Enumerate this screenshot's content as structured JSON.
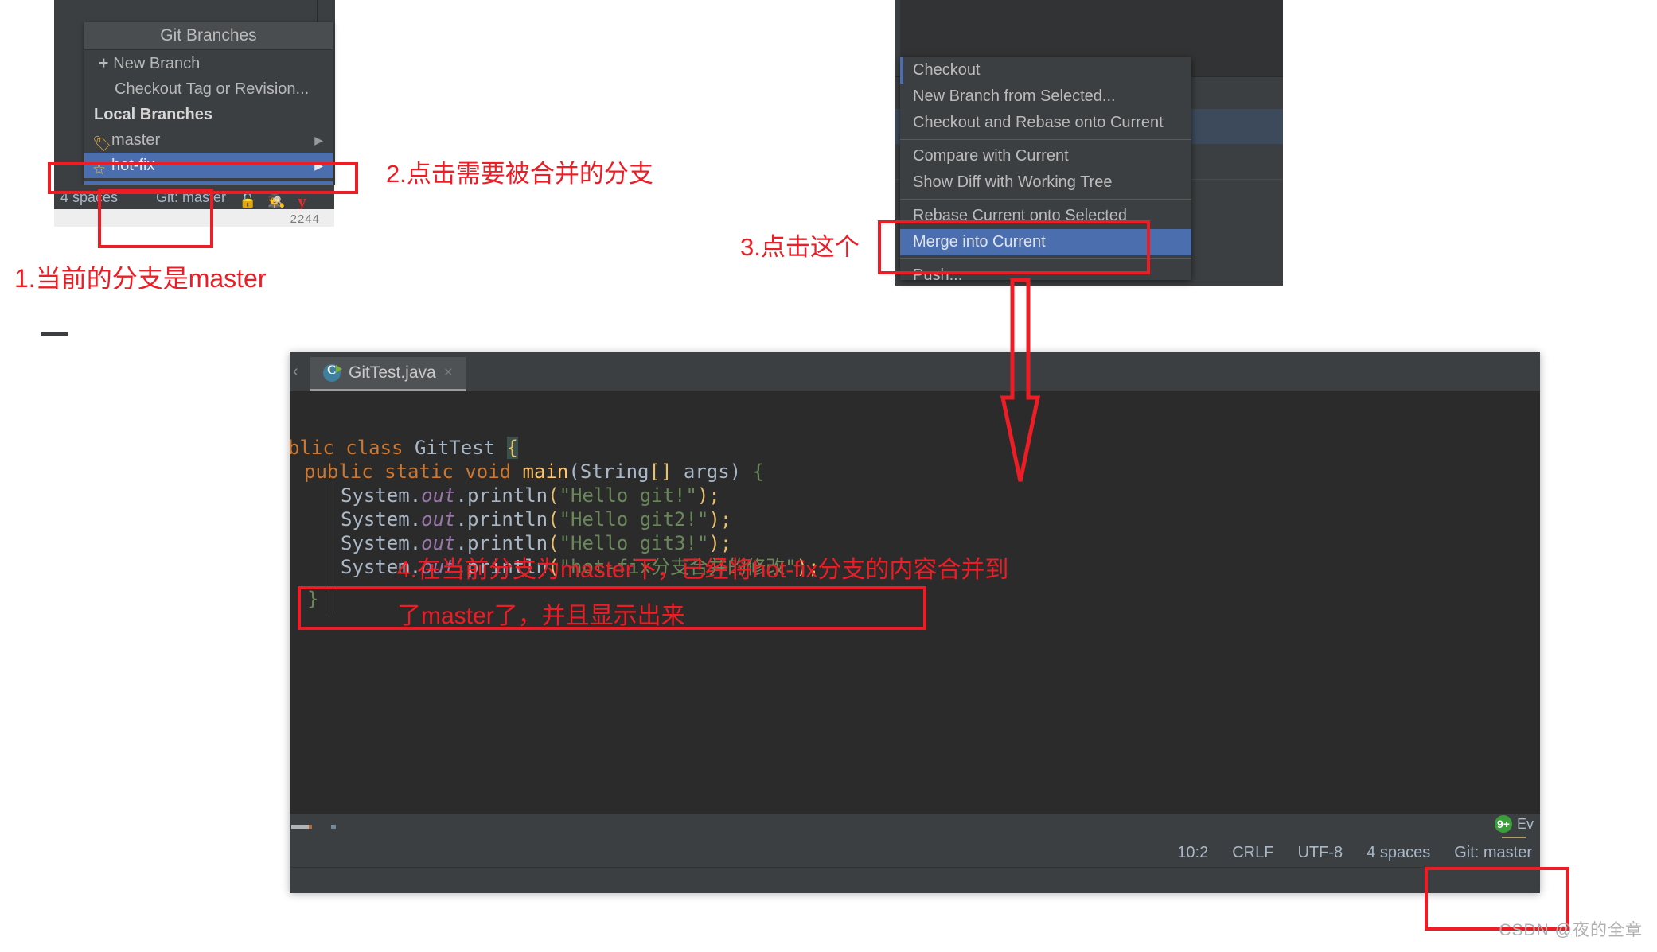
{
  "git_branches_popup": {
    "title": "Git Branches",
    "new_branch": "New Branch",
    "checkout_tag": "Checkout Tag or Revision...",
    "local_branches_header": "Local Branches",
    "branches": [
      {
        "name": "master",
        "icon": "tag-icon",
        "selected": false
      },
      {
        "name": "hot-fix",
        "icon": "star-icon",
        "selected": true
      }
    ]
  },
  "left_status_bar": {
    "indent": "4 spaces",
    "git_branch": "Git: master",
    "icons": [
      "lock-open-icon",
      "inspector-icon",
      "youtrack-icon"
    ],
    "youtrack_glyph": "y",
    "under_number": "2244"
  },
  "context_menu": {
    "items": [
      {
        "label": "Checkout",
        "highlight": false,
        "separator_after": false
      },
      {
        "label": "New Branch from Selected...",
        "highlight": false,
        "separator_after": false
      },
      {
        "label": "Checkout and Rebase onto Current",
        "highlight": false,
        "separator_after": true
      },
      {
        "label": "Compare with Current",
        "highlight": false,
        "separator_after": false
      },
      {
        "label": "Show Diff with Working Tree",
        "highlight": false,
        "separator_after": true
      },
      {
        "label": "Rebase Current onto Selected",
        "highlight": false,
        "separator_after": false
      },
      {
        "label": "Merge into Current",
        "highlight": true,
        "separator_after": true
      },
      {
        "label": "Push...",
        "highlight": false,
        "separator_after": false
      }
    ]
  },
  "editor": {
    "tab": {
      "filename": "GitTest.java",
      "icon": "java-class-icon",
      "close": "×"
    },
    "chevron": "‹",
    "code_lines": [
      "blic class GitTest {",
      "  public static void main(String[] args) {",
      "      System.out.println(\"Hello git!\");",
      "      System.out.println(\"Hello git2!\");",
      "      System.out.println(\"Hello git3!\");",
      "      System.out.println(\"hot-fix分支合并的修改\");",
      "  }"
    ],
    "event_log": {
      "badge": "9+",
      "label": "Ev"
    },
    "status_bar": {
      "caret": "10:2",
      "line_separator": "CRLF",
      "encoding": "UTF-8",
      "indent": "4 spaces",
      "git_branch": "Git: master"
    }
  },
  "annotations": {
    "note1": "1.当前的分支是master",
    "note2": "2.点击需要被合并的分支",
    "note3": "3.点击这个",
    "note4_line1": "4.在当前分支为master下，已经将hot-fix分支的内容合并到",
    "note4_line2": "了master了，并且显示出来"
  },
  "watermark": "CSDN @夜的全章",
  "colors": {
    "annotation_red": "#ee1c25",
    "selection_blue": "#4b6eaf",
    "ide_panel": "#3c3f41",
    "editor_bg": "#2b2b2b"
  }
}
